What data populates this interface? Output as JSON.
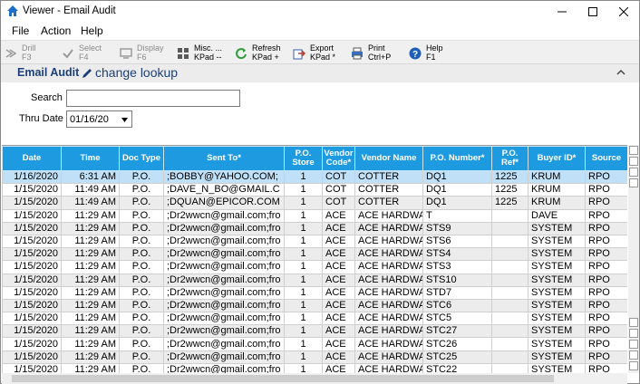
{
  "window": {
    "title": "Viewer - Email Audit"
  },
  "menu": [
    "File",
    "Action",
    "Help"
  ],
  "toolbar": [
    {
      "l1": "Drill",
      "l2": "F3",
      "icon": "drill-icon",
      "disabled": true
    },
    {
      "l1": "Select",
      "l2": "F4",
      "icon": "check-icon",
      "disabled": true
    },
    {
      "l1": "Display",
      "l2": "F6",
      "icon": "display-icon",
      "disabled": true
    },
    {
      "l1": "Misc. ...",
      "l2": "KPad --",
      "icon": "misc-icon",
      "disabled": false
    },
    {
      "l1": "Refresh",
      "l2": "KPad +",
      "icon": "refresh-icon",
      "disabled": false
    },
    {
      "l1": "Export",
      "l2": "KPad *",
      "icon": "export-icon",
      "disabled": false
    },
    {
      "l1": "Print",
      "l2": "Ctrl+P",
      "icon": "print-icon",
      "disabled": false
    },
    {
      "l1": "Help",
      "l2": "F1",
      "icon": "help-icon",
      "disabled": false
    }
  ],
  "section": {
    "heading": "Email Audit",
    "link": "change lookup"
  },
  "form": {
    "search_label": "Search",
    "search_value": "",
    "thru_label": "Thru Date",
    "thru_value": "01/16/20"
  },
  "grid": {
    "columns": [
      "Date",
      "Time",
      "Doc Type",
      "Sent To*",
      "P.O. Store",
      "Vendor Code*",
      "Vendor Name",
      "P.O. Number*",
      "P.O. Ref*",
      "Buyer ID*",
      "Source"
    ],
    "rows": [
      [
        "1/16/2020",
        "6:31 AM",
        "P.O.",
        ";BOBBY@YAHOO.COM;",
        "1",
        "COT",
        "COTTER",
        "DQ1",
        "1225",
        "KRUM",
        "RPO"
      ],
      [
        "1/15/2020",
        "11:49 AM",
        "P.O.",
        ";DAVE_N_BO@GMAIL.C",
        "1",
        "COT",
        "COTTER",
        "DQ1",
        "1225",
        "KRUM",
        "RPO"
      ],
      [
        "1/15/2020",
        "11:49 AM",
        "P.O.",
        ";DQUAN@EPICOR.COM",
        "1",
        "COT",
        "COTTER",
        "DQ1",
        "1225",
        "KRUM",
        "RPO"
      ],
      [
        "1/15/2020",
        "11:29 AM",
        "P.O.",
        ";Dr2wwcn@gmail.com;fro",
        "1",
        "ACE",
        "ACE HARDWA",
        "T",
        "",
        "DAVE",
        "RPO"
      ],
      [
        "1/15/2020",
        "11:29 AM",
        "P.O.",
        ";Dr2wwcn@gmail.com;fro",
        "1",
        "ACE",
        "ACE HARDWA",
        "STS9",
        "",
        "SYSTEM",
        "RPO"
      ],
      [
        "1/15/2020",
        "11:29 AM",
        "P.O.",
        ";Dr2wwcn@gmail.com;fro",
        "1",
        "ACE",
        "ACE HARDWA",
        "STS6",
        "",
        "SYSTEM",
        "RPO"
      ],
      [
        "1/15/2020",
        "11:29 AM",
        "P.O.",
        ";Dr2wwcn@gmail.com;fro",
        "1",
        "ACE",
        "ACE HARDWA",
        "STS4",
        "",
        "SYSTEM",
        "RPO"
      ],
      [
        "1/15/2020",
        "11:29 AM",
        "P.O.",
        ";Dr2wwcn@gmail.com;fro",
        "1",
        "ACE",
        "ACE HARDWA",
        "STS3",
        "",
        "SYSTEM",
        "RPO"
      ],
      [
        "1/15/2020",
        "11:29 AM",
        "P.O.",
        ";Dr2wwcn@gmail.com;fro",
        "1",
        "ACE",
        "ACE HARDWA",
        "STS10",
        "",
        "SYSTEM",
        "RPO"
      ],
      [
        "1/15/2020",
        "11:29 AM",
        "P.O.",
        ";Dr2wwcn@gmail.com;fro",
        "1",
        "ACE",
        "ACE HARDWA",
        "STD7",
        "",
        "SYSTEM",
        "RPO"
      ],
      [
        "1/15/2020",
        "11:29 AM",
        "P.O.",
        ";Dr2wwcn@gmail.com;fro",
        "1",
        "ACE",
        "ACE HARDWA",
        "STC6",
        "",
        "SYSTEM",
        "RPO"
      ],
      [
        "1/15/2020",
        "11:29 AM",
        "P.O.",
        ";Dr2wwcn@gmail.com;fro",
        "1",
        "ACE",
        "ACE HARDWA",
        "STC5",
        "",
        "SYSTEM",
        "RPO"
      ],
      [
        "1/15/2020",
        "11:29 AM",
        "P.O.",
        ";Dr2wwcn@gmail.com;fro",
        "1",
        "ACE",
        "ACE HARDWA",
        "STC27",
        "",
        "SYSTEM",
        "RPO"
      ],
      [
        "1/15/2020",
        "11:29 AM",
        "P.O.",
        ";Dr2wwcn@gmail.com;fro",
        "1",
        "ACE",
        "ACE HARDWA",
        "STC26",
        "",
        "SYSTEM",
        "RPO"
      ],
      [
        "1/15/2020",
        "11:29 AM",
        "P.O.",
        ";Dr2wwcn@gmail.com;fro",
        "1",
        "ACE",
        "ACE HARDWA",
        "STC25",
        "",
        "SYSTEM",
        "RPO"
      ],
      [
        "1/15/2020",
        "11:29 AM",
        "P.O.",
        ";Dr2wwcn@gmail.com;fro",
        "1",
        "ACE",
        "ACE HARDWA",
        "STC22",
        "",
        "SYSTEM",
        "RPO"
      ]
    ]
  },
  "colors": {
    "header": "#1e9be0",
    "selected_row": "#bfe0f7",
    "alt_row": "#ececec",
    "heading": "#1c3f7a"
  }
}
